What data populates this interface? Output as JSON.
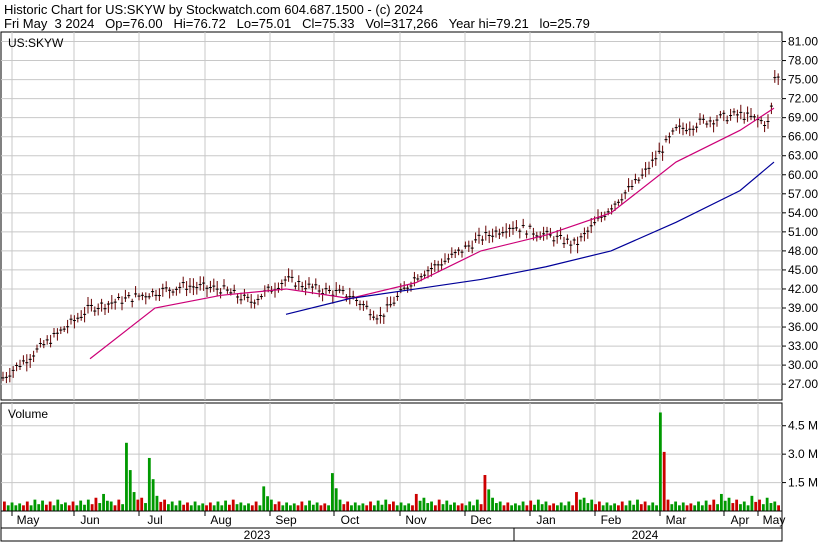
{
  "header": {
    "line1": "Historic Chart for US:SKYW by Stockwatch.com 604.687.1500 - (c) 2024",
    "line2": "Fri May  3 2024   Op=76.00   Hi=76.72   Lo=75.01   Cl=75.33   Vol=317,266   Year hi=79.21   lo=25.79"
  },
  "chart_data": [
    {
      "type": "candlestick",
      "title": "US:SKYW",
      "x_labels": [
        "May",
        "Jun",
        "Jul",
        "Aug",
        "Sep",
        "Oct",
        "Nov",
        "Dec",
        "Jan",
        "Feb",
        "Mar",
        "Apr",
        "May"
      ],
      "years": [
        "2023",
        "2024"
      ],
      "ylim": [
        24.5,
        82.5
      ],
      "y_ticks": [
        "27.00",
        "30.00",
        "33.00",
        "36.00",
        "39.00",
        "42.00",
        "45.00",
        "48.00",
        "51.00",
        "54.00",
        "57.00",
        "60.00",
        "63.00",
        "66.00",
        "69.00",
        "72.00",
        "75.00",
        "78.00",
        "81.00"
      ],
      "grid": true,
      "close_path": [
        [
          "May",
          28.0
        ],
        [
          "Jun",
          39.0
        ],
        [
          "Jul",
          41.5
        ],
        [
          "Jul",
          42.5
        ],
        [
          "Aug",
          42.0
        ],
        [
          "Aug",
          40.0
        ],
        [
          "Sep",
          43.5
        ],
        [
          "Sep",
          42.0
        ],
        [
          "Oct",
          41.0
        ],
        [
          "Oct",
          37.5
        ],
        [
          "Nov",
          44.0
        ],
        [
          "Nov",
          46.5
        ],
        [
          "Dec",
          50.0
        ],
        [
          "Dec",
          52.0
        ],
        [
          "Jan",
          50.5
        ],
        [
          "Jan",
          49.0
        ],
        [
          "Feb",
          55.0
        ],
        [
          "Feb",
          59.5
        ],
        [
          "Mar",
          67.0
        ],
        [
          "Mar",
          68.5
        ],
        [
          "Apr",
          69.5
        ],
        [
          "Apr",
          68.0
        ],
        [
          "May",
          75.3
        ]
      ],
      "series": [
        {
          "name": "",
          "color": "#cc0077",
          "values": [
            [
              31.0,
              "Jun"
            ],
            [
              39.0,
              "Jul"
            ],
            [
              41.0,
              "Aug"
            ],
            [
              42.0,
              "Sep"
            ],
            [
              40.5,
              "Oct"
            ],
            [
              43.0,
              "Nov"
            ],
            [
              48.0,
              "Dec"
            ],
            [
              50.5,
              "Jan"
            ],
            [
              54.0,
              "Feb"
            ],
            [
              62.0,
              "Mar"
            ],
            [
              67.0,
              "Apr"
            ],
            [
              70.5,
              "May"
            ]
          ]
        },
        {
          "name": "",
          "color": "#000099",
          "values": [
            [
              38.0,
              "Sep"
            ],
            [
              40.5,
              "Oct"
            ],
            [
              42.0,
              "Nov"
            ],
            [
              43.5,
              "Dec"
            ],
            [
              45.5,
              "Jan"
            ],
            [
              48.0,
              "Feb"
            ],
            [
              52.5,
              "Mar"
            ],
            [
              57.5,
              "Apr"
            ],
            [
              62.0,
              "May"
            ]
          ]
        }
      ]
    },
    {
      "type": "bar",
      "title": "Volume",
      "y_ticks": [
        "1.5 M",
        "3.0 M",
        "4.5 M"
      ],
      "ylim": [
        0,
        5.7
      ],
      "colors": {
        "up": "#009900",
        "down": "#cc0000"
      },
      "values": [
        0.5,
        0.45,
        0.4,
        0.5,
        0.6,
        0.55,
        0.5,
        0.6,
        0.45,
        0.5,
        0.55,
        0.6,
        0.7,
        0.9,
        0.5,
        0.6,
        3.6,
        1.0,
        0.7,
        2.8,
        0.8,
        0.6,
        0.5,
        0.55,
        0.45,
        0.5,
        0.4,
        0.45,
        0.5,
        0.55,
        0.6,
        0.45,
        0.4,
        0.5,
        1.3,
        0.6,
        0.5,
        0.45,
        0.4,
        0.5,
        0.55,
        0.45,
        0.4,
        2.0,
        0.6,
        0.5,
        0.45,
        0.4,
        0.5,
        0.55,
        0.6,
        0.5,
        0.45,
        0.4,
        0.9,
        0.7,
        0.5,
        0.6,
        0.55,
        0.45,
        0.4,
        0.5,
        0.6,
        1.9,
        0.7,
        0.5,
        0.45,
        0.4,
        0.5,
        0.55,
        0.6,
        0.5,
        0.4,
        0.45,
        0.5,
        1.0,
        0.7,
        0.6,
        0.5,
        0.45,
        0.4,
        0.5,
        0.55,
        0.6,
        0.5,
        0.45,
        5.2,
        0.6,
        0.5,
        0.45,
        0.4,
        0.5,
        0.55,
        0.6,
        0.9,
        0.7,
        0.6,
        0.5,
        0.8,
        0.6,
        0.7,
        0.5
      ]
    }
  ]
}
